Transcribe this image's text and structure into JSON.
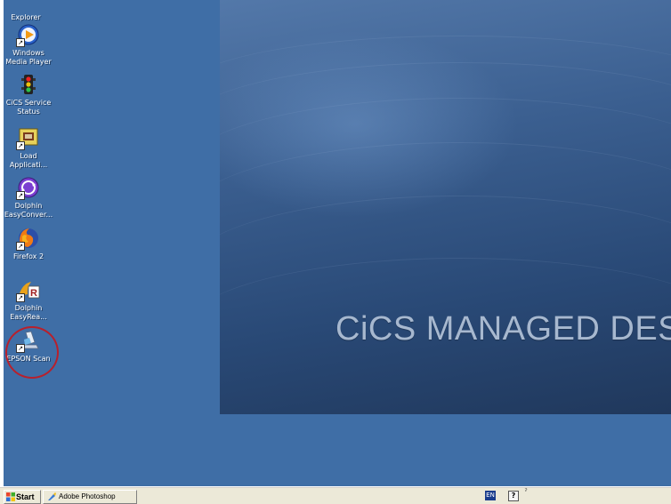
{
  "desktop": {
    "background_color": "#3f6ea6",
    "wallpaper_text": "CiCS MANAGED DES",
    "icons": [
      {
        "label": "Explorer",
        "icon": "internet-explorer-icon"
      },
      {
        "label": "Windows\nMedia Player",
        "icon": "windows-media-player-icon"
      },
      {
        "label": "CiCS Service\nStatus",
        "icon": "traffic-light-icon"
      },
      {
        "label": "Load\nApplicati...",
        "icon": "load-application-icon"
      },
      {
        "label": "Dolphin\nEasyConver...",
        "icon": "dolphin-easyconverter-icon"
      },
      {
        "label": "Firefox 2",
        "icon": "firefox-icon"
      },
      {
        "label": "Dolphin\nEasyRea...",
        "icon": "dolphin-easyreader-icon"
      },
      {
        "label": "EPSON Scan",
        "icon": "epson-scan-icon"
      }
    ],
    "highlight_color": "#b8202c"
  },
  "taskbar": {
    "start_label": "Start",
    "tasks": [
      {
        "label": "Adobe Photoshop",
        "icon": "photoshop-icon"
      }
    ],
    "tray": {
      "language": "EN",
      "help_glyph": "?",
      "pin_glyph": "ˀ"
    }
  }
}
